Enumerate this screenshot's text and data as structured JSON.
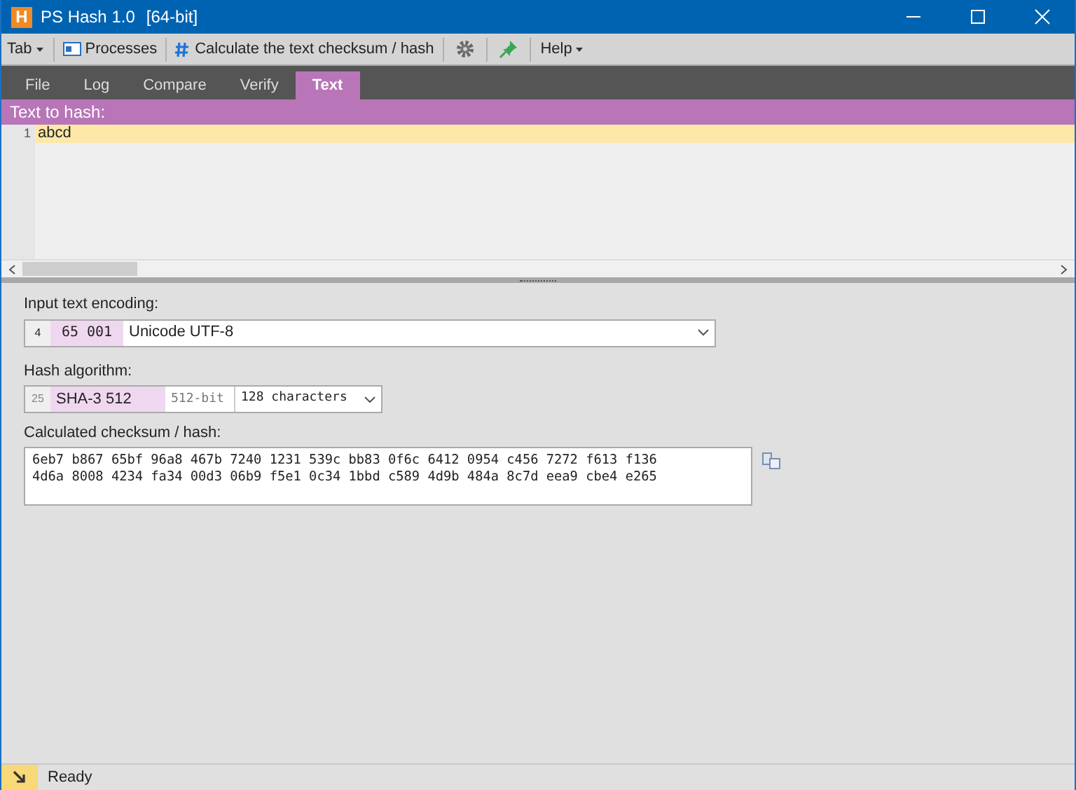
{
  "window": {
    "app_icon": "H",
    "title": "PS Hash 1.0",
    "subtitle": "[64-bit]"
  },
  "toolbar": [
    {
      "kind": "menu",
      "label": "Tab"
    },
    {
      "kind": "processes",
      "label": "Processes"
    },
    {
      "kind": "hash",
      "label": "Calculate the text checksum / hash"
    },
    {
      "kind": "settings"
    },
    {
      "kind": "pin"
    },
    {
      "kind": "menu",
      "label": "Help"
    }
  ],
  "tabs": [
    {
      "label": "File",
      "selected": false
    },
    {
      "label": "Log",
      "selected": false
    },
    {
      "label": "Compare",
      "selected": false
    },
    {
      "label": "Verify",
      "selected": false
    },
    {
      "label": "Text",
      "selected": true
    }
  ],
  "editor": {
    "header": "Text to hash:",
    "lines": [
      {
        "number": "1",
        "text": "abcd"
      }
    ]
  },
  "encoding": {
    "label": "Input text encoding:",
    "index": "4",
    "code": "65 001",
    "name": "Unicode UTF-8"
  },
  "algorithm": {
    "label": "Hash algorithm:",
    "index": "25",
    "name": "SHA-3 512",
    "bits": "512-bit",
    "length": "128 characters"
  },
  "result": {
    "label": "Calculated checksum / hash:",
    "lines": [
      "6eb7 b867 65bf 96a8 467b 7240 1231 539c bb83 0f6c 6412 0954 c456 7272 f613 f136",
      "4d6a 8008 4234 fa34 00d3 06b9 f5e1 0c34 1bbd c589 4d9b 484a 8c7d eea9 cbe4 e265"
    ]
  },
  "status_bar": {
    "text": "Ready"
  }
}
